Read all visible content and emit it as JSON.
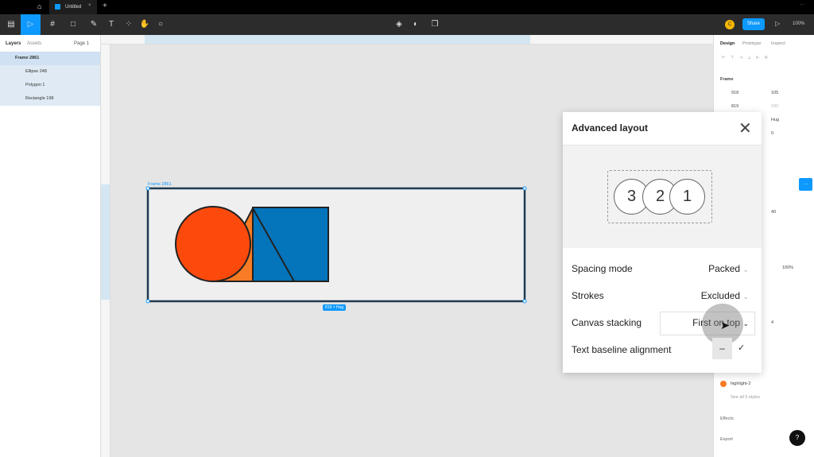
{
  "tab": {
    "title": "Untitled"
  },
  "toolbar": {
    "share": "Share",
    "zoom": "100%",
    "avatar": "C"
  },
  "left": {
    "tabs": [
      "Layers",
      "Assets"
    ],
    "page": "Page 1",
    "layers": [
      "Frame 2861",
      "Ellipse 248",
      "Polygon 1",
      "Rectangle 198"
    ]
  },
  "canvas": {
    "frame_label": "Frame 2861",
    "size_badge": "819 × Hug"
  },
  "right": {
    "tabs": [
      "Design",
      "Prototype",
      "Inspect"
    ],
    "frame": "Frame",
    "x": "918",
    "y": "105",
    "w": "819",
    "h": "240",
    "hug": "Hug",
    "gap": "0",
    "spacing": "40",
    "opacity": "100%",
    "stroke": "4",
    "style": "highlight-2",
    "see_all": "See all 5 styles",
    "effects": "Effects",
    "export": "Export",
    "help": "?"
  },
  "dialog": {
    "title": "Advanced layout",
    "preview": [
      "1",
      "2",
      "3"
    ],
    "rows": [
      {
        "label": "Spacing mode",
        "value": "Packed"
      },
      {
        "label": "Strokes",
        "value": "Excluded"
      },
      {
        "label": "Canvas stacking",
        "value": "First on top"
      },
      {
        "label": "Text baseline alignment",
        "value": "–"
      }
    ]
  },
  "colors": {
    "accent": "#0d99ff",
    "circle": "#fc4a0d",
    "triangle": "#f97b25",
    "rect": "#0474bb"
  }
}
